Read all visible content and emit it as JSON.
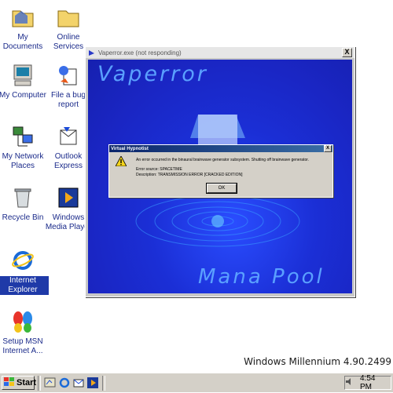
{
  "desktop": {
    "icons": [
      {
        "label": "My Documents"
      },
      {
        "label": "Online Services"
      },
      {
        "label": "My Computer"
      },
      {
        "label": "File a bug report"
      },
      {
        "label": "My Network Places"
      },
      {
        "label": "Outlook Express"
      },
      {
        "label": "Recycle Bin"
      },
      {
        "label": "Windows Media Player"
      },
      {
        "label": "Internet Explorer"
      },
      {
        "label": "Setup MSN Internet A..."
      }
    ]
  },
  "window": {
    "title": "Vaperror.exe (not responding)",
    "heading": "Vaperror",
    "footer": "Mana Pool",
    "close": "X"
  },
  "dialog": {
    "title": "Virtual Hypnotist",
    "close": "X",
    "message": "An error occurred in the binaural brainwave generator subsystem. Shutting off brainwave generator.",
    "source": "Error source: SPACETIME",
    "description": "Description: TRANSMISSION ERROR [CRACKED EDITION]",
    "ok_label": "OK"
  },
  "watermark": "Windows Millennium 4.90.2499",
  "taskbar": {
    "start_label": "Start",
    "clock": "4:54 PM"
  }
}
